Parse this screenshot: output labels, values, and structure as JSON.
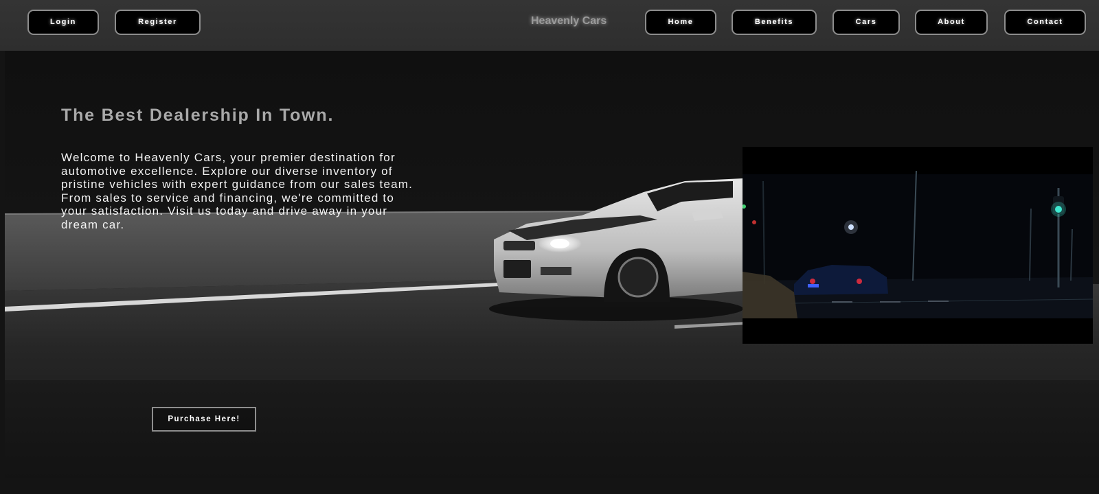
{
  "nav": {
    "login": "Login",
    "register": "Register",
    "brand": "Heavenly Cars",
    "home": "Home",
    "benefits": "Benefits",
    "cars": "Cars",
    "about": "About",
    "contact": "Contact"
  },
  "hero": {
    "headline": "The Best Dealership In Town.",
    "intro": "Welcome to Heavenly Cars, your premier destination for automotive excellence. Explore our diverse inventory of pristine vehicles with expert guidance from our sales team. From sales to service and financing, we're committed to your satisfaction. Visit us today and drive away in your dream car.",
    "cta": "Purchase Here!"
  },
  "colors": {
    "topbar": "#333333",
    "button_bg": "#000000",
    "button_border": "#8d8d8d",
    "hero_bg": "#121212",
    "headline": "#a9a9a9",
    "body_text": "#f2f2f2",
    "traffic_light": "#3fe8d0"
  }
}
